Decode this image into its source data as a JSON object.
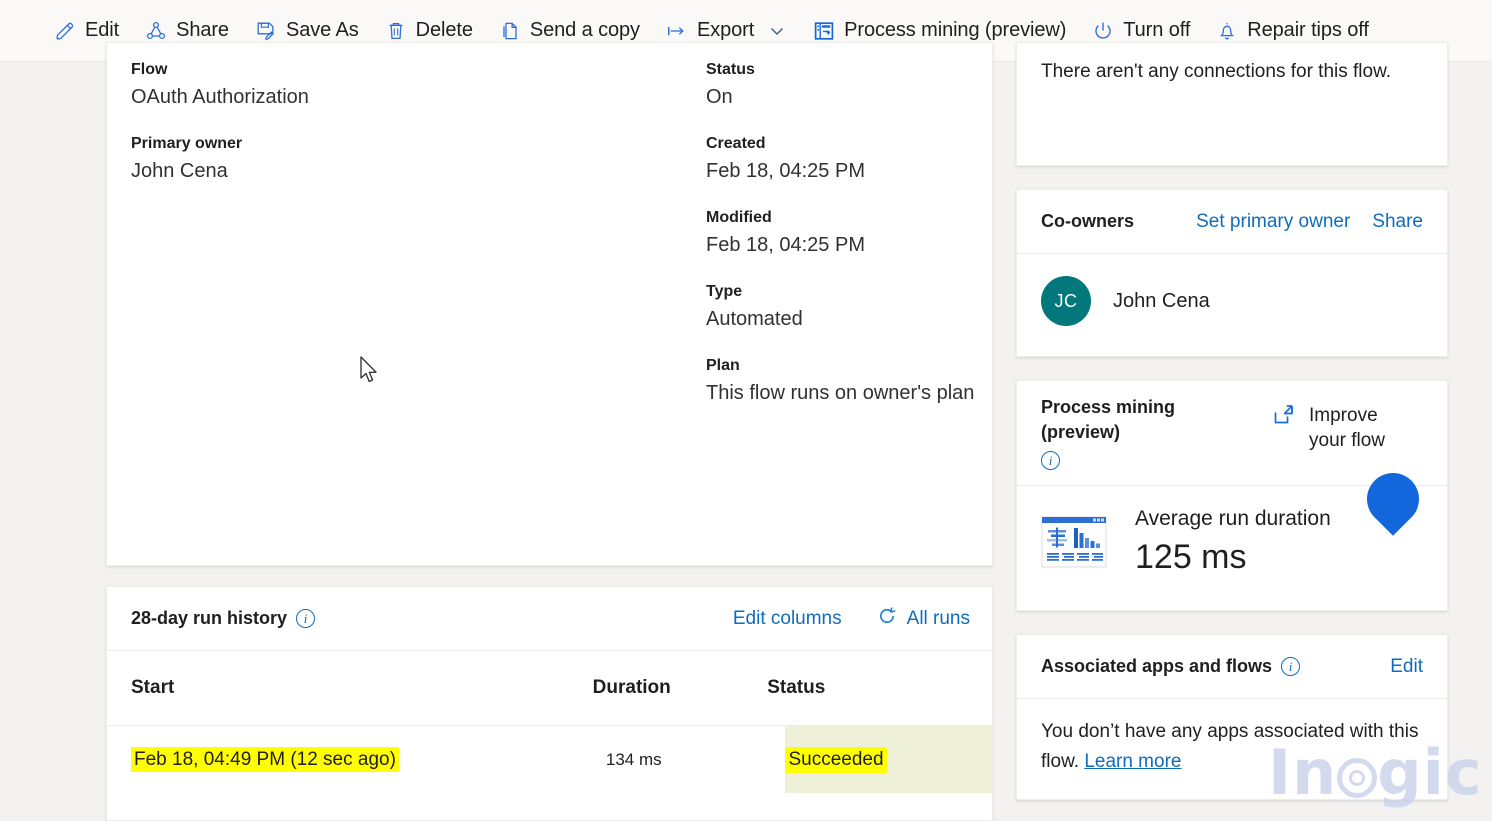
{
  "commandbar": {
    "items": [
      {
        "label": "Edit",
        "icon": "pencil-icon"
      },
      {
        "label": "Share",
        "icon": "share-icon"
      },
      {
        "label": "Save As",
        "icon": "save-as-icon"
      },
      {
        "label": "Delete",
        "icon": "trash-icon"
      },
      {
        "label": "Send a copy",
        "icon": "copy-icon"
      },
      {
        "label": "Export",
        "icon": "export-icon",
        "chevron": true
      },
      {
        "label": "Process mining (preview)",
        "icon": "process-mining-icon"
      },
      {
        "label": "Turn off",
        "icon": "power-icon"
      },
      {
        "label": "Repair tips off",
        "icon": "bell-icon"
      }
    ]
  },
  "details": {
    "left": [
      {
        "label": "Flow",
        "value": "OAuth Authorization"
      },
      {
        "label": "Primary owner",
        "value": "John Cena"
      }
    ],
    "right": [
      {
        "label": "Status",
        "value": "On"
      },
      {
        "label": "Created",
        "value": "Feb 18, 04:25 PM"
      },
      {
        "label": "Modified",
        "value": "Feb 18, 04:25 PM"
      },
      {
        "label": "Type",
        "value": "Automated"
      },
      {
        "label": "Plan",
        "value": "This flow runs on owner's plan"
      }
    ]
  },
  "run_history": {
    "title": "28-day run history",
    "info_glyph": "i",
    "edit_columns_label": "Edit columns",
    "all_runs_label": "All runs",
    "columns": [
      "Start",
      "Duration",
      "Status"
    ],
    "rows": [
      {
        "start": "Feb 18, 04:49 PM (12 sec ago)",
        "duration": "134 ms",
        "status": "Succeeded"
      }
    ]
  },
  "rail": {
    "connections": {
      "body": "There aren't any connections for this flow."
    },
    "coowners": {
      "title": "Co-owners",
      "set_primary_owner_label": "Set primary owner",
      "share_label": "Share",
      "members": [
        {
          "initials": "JC",
          "name": "John Cena"
        }
      ]
    },
    "process_mining": {
      "title": "Process mining (preview)",
      "info_glyph": "i",
      "improve_label": "Improve your flow",
      "metric_label": "Average run duration",
      "metric_value": "125 ms"
    },
    "associated": {
      "title": "Associated apps and flows",
      "info_glyph": "i",
      "edit_label": "Edit",
      "body_text": "You don’t have any apps associated with this flow. ",
      "learn_more_label": "Learn more"
    }
  },
  "watermark": {
    "part1": "In",
    "part2": "g",
    "part3": "ic"
  },
  "colors": {
    "accent": "#0f6cbd",
    "avatar": "#03787c",
    "highlight": "#ffff00",
    "status_cell": "#eef0d8",
    "droplet": "#1367dd",
    "page_bg": "#f3f2f1"
  }
}
